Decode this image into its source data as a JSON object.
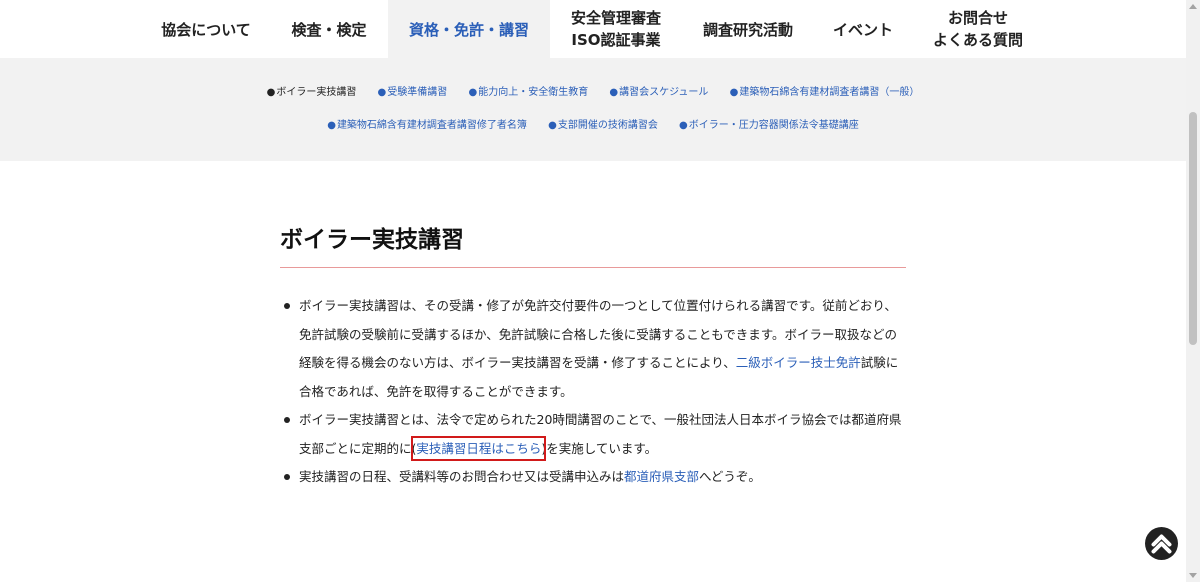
{
  "nav": {
    "items": [
      {
        "label": "協会について"
      },
      {
        "label": "検査・検定"
      },
      {
        "label": "資格・免許・講習"
      },
      {
        "line1": "安全管理審査",
        "line2": "ISO認証事業"
      },
      {
        "label": "調査研究活動"
      },
      {
        "label": "イベント"
      },
      {
        "line1": "お問合せ",
        "line2": "よくある質問"
      }
    ],
    "active_color": "#2b5fb8"
  },
  "subnav": {
    "row1": [
      "ボイラー実技講習",
      "受験準備講習",
      "能力向上・安全衛生教育",
      "講習会スケジュール",
      "建築物石綿含有建材調査者講習（一般）"
    ],
    "row2": [
      "建築物石綿含有建材調査者講習修了者名簿",
      "支部開催の技術講習会",
      "ボイラー・圧力容器関係法令基礎講座"
    ],
    "bullet": "●"
  },
  "page": {
    "title": "ボイラー実技講習",
    "rule_color": "#e89a9a"
  },
  "content": {
    "p1": {
      "l1": "ボイラー実技講習は、その受講・修了が免許交付要件の一つとして位置付けられる講習です。従前どおり、",
      "l2": "免許試験の受験前に受講するほか、免許試験に合格した後に受講することもできます。ボイラー取扱などの",
      "l3": "経験を得る機会のない方は、ボイラー実技講習を受講・修了することにより、",
      "l3_link": "二級ボイラー技士免許",
      "l3_after": "試験に",
      "l4": "合格であれば、免許を取得することができます。"
    },
    "p2": {
      "l1": "ボイラー実技講習とは、法令で定められた20時間講習のことで、一般社団法人日本ボイラ協会では都道府県",
      "l2_before": "支部ごとに定期的に(",
      "l2_link": "実技講習日程はこちら",
      "l2_after": ")を実施しています。"
    },
    "p3": {
      "before": "実技講習の日程、受講料等のお問合わせ又は受講申込みは",
      "link": "都道府県支部",
      "after": "へどうぞ。"
    }
  },
  "widgets": {
    "to_top_icon": "chevron-up-icon",
    "highlight_color": "#d11a1a"
  }
}
